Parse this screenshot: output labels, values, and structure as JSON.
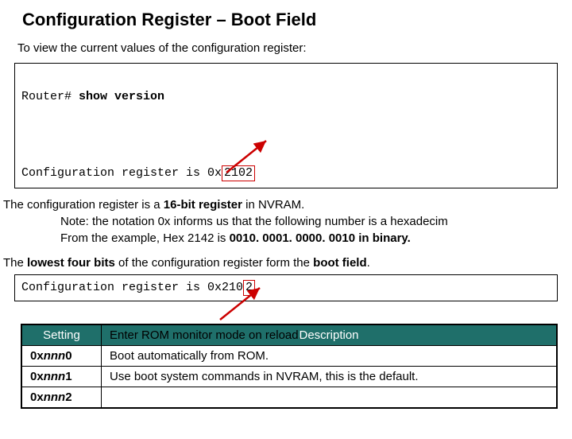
{
  "title": "Configuration Register – Boot Field",
  "intro": "To view the current values of the configuration register:",
  "terminal": {
    "prompt": "Router#",
    "command": "show version",
    "result_prefix": "Configuration register is 0x",
    "result_boxed": "2102"
  },
  "body": {
    "line1_pre": "The configuration register is a ",
    "line1_bold": "16-bit register",
    "line1_post": " in NVRAM.",
    "note_pre": "Note: the notation 0x informs us that the following number is a hexadecim",
    "example_pre": "From the example, Hex 2142 is ",
    "example_bold": "0010. 0001. 0000. 0010 in binary.",
    "line2_pre": "The ",
    "line2_bold": "lowest four bits",
    "line2_mid": " of the configuration register form the ",
    "line2_bold2": "boot field",
    "line2_post": "."
  },
  "terminal2": {
    "text_prefix": "Configuration register is 0x210",
    "boxed": "2"
  },
  "table": {
    "headers": {
      "setting": "Setting",
      "description": "Description"
    },
    "rows": [
      {
        "setting_pre": "0x",
        "setting_ital": "nnn",
        "setting_suf": "0",
        "desc": "Enter ROM monitor mode on reload."
      },
      {
        "setting_pre": "0x",
        "setting_ital": "nnn",
        "setting_suf": "1",
        "desc": "Boot automatically from ROM."
      },
      {
        "setting_pre": "0x",
        "setting_ital": "nnn",
        "setting_suf": "2",
        "desc": "Use boot system commands in NVRAM, this is the default."
      }
    ]
  },
  "overlap": {
    "desc_row1": "Enter ROM monitor mode on reload.",
    "desc_header": "Description"
  }
}
